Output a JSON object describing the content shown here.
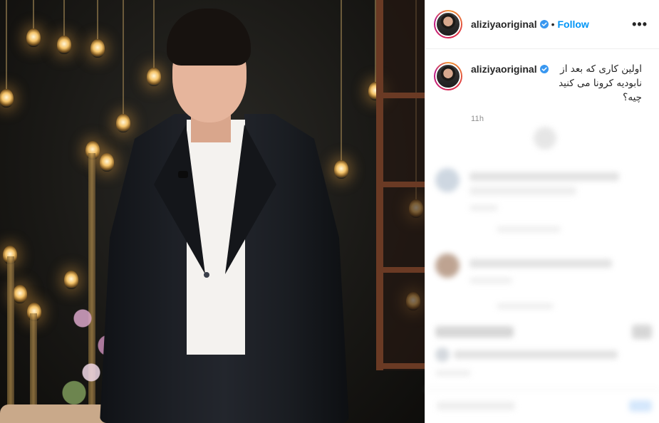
{
  "post": {
    "username": "aliziyaoriginal",
    "follow_label": "Follow",
    "separator": "•",
    "more_label": "•••"
  },
  "caption": {
    "username": "aliziyaoriginal",
    "text": "اولین کاری که بعد از نابودیه کرونا می کنید چیه؟",
    "time": "11h"
  },
  "icons": {
    "verified": "verified-badge-icon",
    "more": "more-options-icon"
  },
  "colors": {
    "accent": "#0095f6",
    "text": "#262626",
    "muted": "#8e8e8e"
  }
}
